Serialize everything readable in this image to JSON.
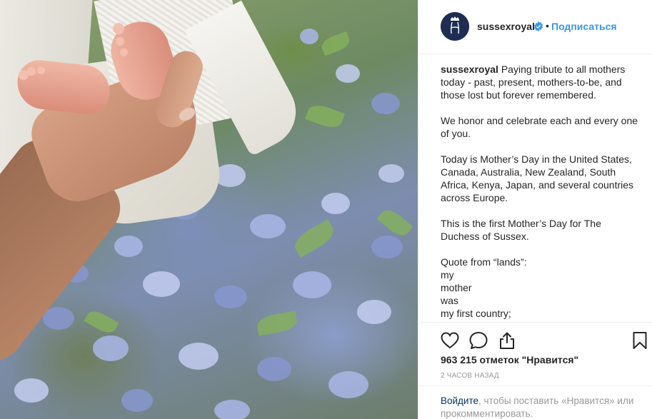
{
  "colors": {
    "link": "#3897f0",
    "login_link": "#003569",
    "muted": "#999999",
    "text": "#262626",
    "avatar_bg": "#1f2d52",
    "verified_badge": "#3897f0"
  },
  "photo": {
    "icon": "photo-baby-feet-in-hand"
  },
  "header": {
    "avatar_icon": "sussex-monogram-icon",
    "username": "sussexroyal",
    "verified_icon": "verified-badge-icon",
    "separator": "•",
    "follow_label": "Подписаться"
  },
  "caption": {
    "username": "sussexroyal",
    "paragraphs": [
      "Paying tribute to all mothers today - past, present, mothers-to-be, and those lost but forever remembered.",
      "We honor and celebrate each and every one of you.",
      "Today is Mother’s Day in the United States, Canada, Australia, New Zealand, South Africa, Kenya, Japan, and several countries across Europe.",
      "This is the first Mother’s Day for The Duchess of Sussex."
    ],
    "quote_lines": [
      "Quote from “lands”:",
      "my",
      "mother",
      "was",
      "my first country;"
    ]
  },
  "actions": {
    "like_icon": "heart-icon",
    "comment_icon": "comment-bubble-icon",
    "share_icon": "share-icon",
    "save_icon": "bookmark-icon"
  },
  "likes": {
    "text": "963 215 отметок \"Нравится\""
  },
  "timestamp": "2 ЧАСОВ НАЗАД",
  "comment": {
    "login_link": "Войдите",
    "rest": ", чтобы поставить «Нравится» или прокомментировать."
  }
}
